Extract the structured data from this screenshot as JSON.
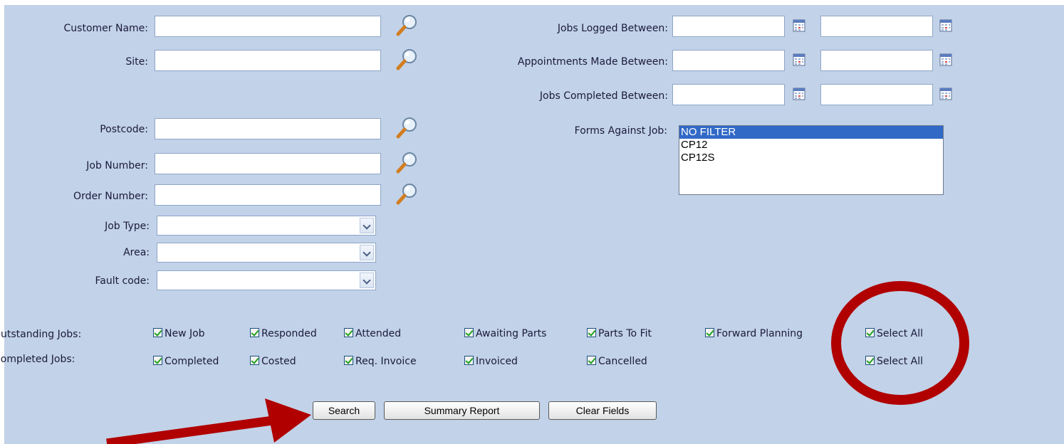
{
  "fields": {
    "customer_name": {
      "label": "Customer Name:",
      "value": ""
    },
    "site": {
      "label": "Site:",
      "value": ""
    },
    "postcode": {
      "label": "Postcode:",
      "value": ""
    },
    "job_number": {
      "label": "Job Number:",
      "value": ""
    },
    "order_number": {
      "label": "Order Number:",
      "value": ""
    },
    "job_type": {
      "label": "Job Type:",
      "value": ""
    },
    "area": {
      "label": "Area:",
      "value": ""
    },
    "fault_code": {
      "label": "Fault code:",
      "value": ""
    }
  },
  "dates": {
    "jobs_logged": {
      "label": "Jobs Logged Between:",
      "from": "",
      "to": ""
    },
    "appointments_made": {
      "label": "Appointments Made Between:",
      "from": "",
      "to": ""
    },
    "jobs_completed": {
      "label": "Jobs Completed Between:",
      "from": "",
      "to": ""
    }
  },
  "forms": {
    "label": "Forms Against Job:",
    "options": [
      "NO FILTER",
      "CP12",
      "CP12S"
    ],
    "selected": "NO FILTER"
  },
  "outstanding": {
    "label": "Outstanding Jobs:",
    "items": [
      "New Job",
      "Responded",
      "Attended",
      "Awaiting Parts",
      "Parts To Fit",
      "Forward Planning",
      "Select All"
    ]
  },
  "completed": {
    "label": "Completed Jobs:",
    "items": [
      "Completed",
      "Costed",
      "Req. Invoice",
      "Invoiced",
      "Cancelled",
      "Select All"
    ]
  },
  "buttons": {
    "search": "Search",
    "summary_report": "Summary Report",
    "clear_fields": "Clear Fields"
  },
  "colors": {
    "panel_bg": "#c2d2e8",
    "annotation": "#b00000",
    "list_selected": "#3169c6",
    "check": "#21a121"
  },
  "icons": {
    "lookup": "magnifier-icon",
    "date": "calendar-icon",
    "dropdown": "chevron-down-icon",
    "check": "checkmark-icon"
  }
}
